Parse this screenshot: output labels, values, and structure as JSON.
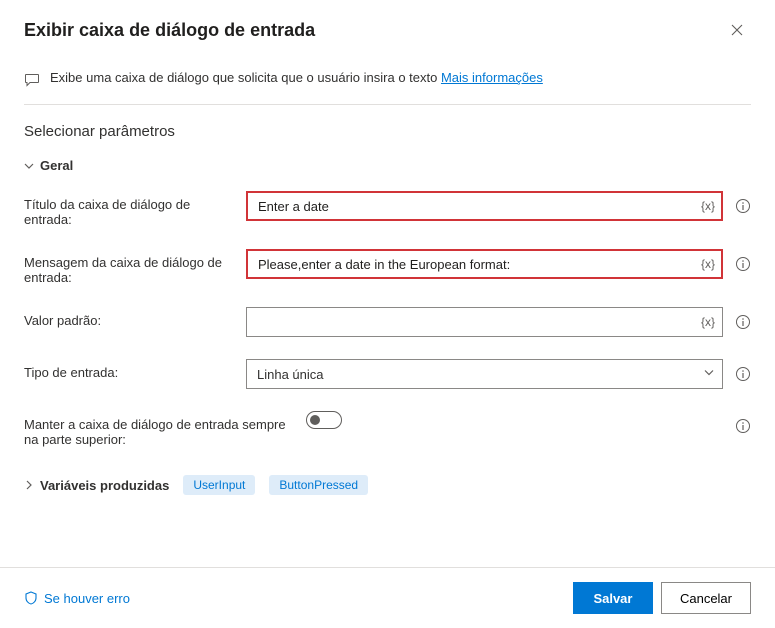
{
  "header": {
    "title": "Exibir caixa de diálogo de entrada"
  },
  "infobar": {
    "text": "Exibe uma caixa de diálogo que solicita que o usuário insira o texto ",
    "link": "Mais informações"
  },
  "params_title": "Selecionar parâmetros",
  "general": {
    "label": "Geral",
    "fields": {
      "title": {
        "label": "Título da caixa de diálogo de entrada:",
        "value": "Enter a date",
        "token": "{x}"
      },
      "message": {
        "label": "Mensagem da caixa de diálogo de entrada:",
        "value": "Please,enter a date in the European format:",
        "token": "{x}"
      },
      "default": {
        "label": "Valor padrão:",
        "value": "",
        "token": "{x}"
      },
      "type": {
        "label": "Tipo de entrada:",
        "value": "Linha única"
      },
      "keeptop": {
        "label": "Manter a caixa de diálogo de entrada sempre na parte superior:"
      }
    }
  },
  "variables": {
    "label": "Variáveis produzidas",
    "pills": [
      "UserInput",
      "ButtonPressed"
    ]
  },
  "footer": {
    "error": "Se houver erro",
    "save": "Salvar",
    "cancel": "Cancelar"
  }
}
